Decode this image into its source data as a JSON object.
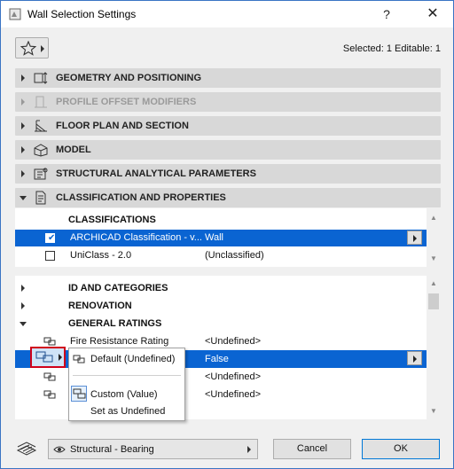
{
  "window": {
    "title": "Wall Selection Settings",
    "help": "?",
    "close": "✕"
  },
  "header": {
    "selected_info": "Selected: 1 Editable: 1"
  },
  "panels": [
    {
      "label": "GEOMETRY AND POSITIONING",
      "icon": "geometry-icon",
      "disabled": false
    },
    {
      "label": "PROFILE OFFSET MODIFIERS",
      "icon": "profile-offset-icon",
      "disabled": true
    },
    {
      "label": "FLOOR PLAN AND SECTION",
      "icon": "floor-plan-icon",
      "disabled": false
    },
    {
      "label": "MODEL",
      "icon": "model-icon",
      "disabled": false
    },
    {
      "label": "STRUCTURAL ANALYTICAL PARAMETERS",
      "icon": "structural-icon",
      "disabled": false
    },
    {
      "label": "CLASSIFICATION AND PROPERTIES",
      "icon": "classification-icon",
      "disabled": false
    }
  ],
  "classifications": {
    "header": "CLASSIFICATIONS",
    "rows": [
      {
        "system": "ARCHICAD Classification - v...",
        "value": "Wall",
        "checked": true
      },
      {
        "system": "UniClass - 2.0",
        "value": "(Unclassified)",
        "checked": false
      }
    ]
  },
  "properties": {
    "groups": [
      "ID AND CATEGORIES",
      "RENOVATION",
      "GENERAL RATINGS"
    ],
    "rows": [
      {
        "name": "Fire Resistance Rating",
        "value": "<Undefined>"
      },
      {
        "name": "",
        "value": "False"
      },
      {
        "name": "",
        "value": "<Undefined>"
      },
      {
        "name": "",
        "value": "<Undefined>"
      }
    ]
  },
  "popup": {
    "items": [
      "Default (Undefined)",
      "Custom (Value)",
      "Set as Undefined"
    ]
  },
  "footer": {
    "layer": "Structural - Bearing",
    "cancel": "Cancel",
    "ok": "OK"
  }
}
